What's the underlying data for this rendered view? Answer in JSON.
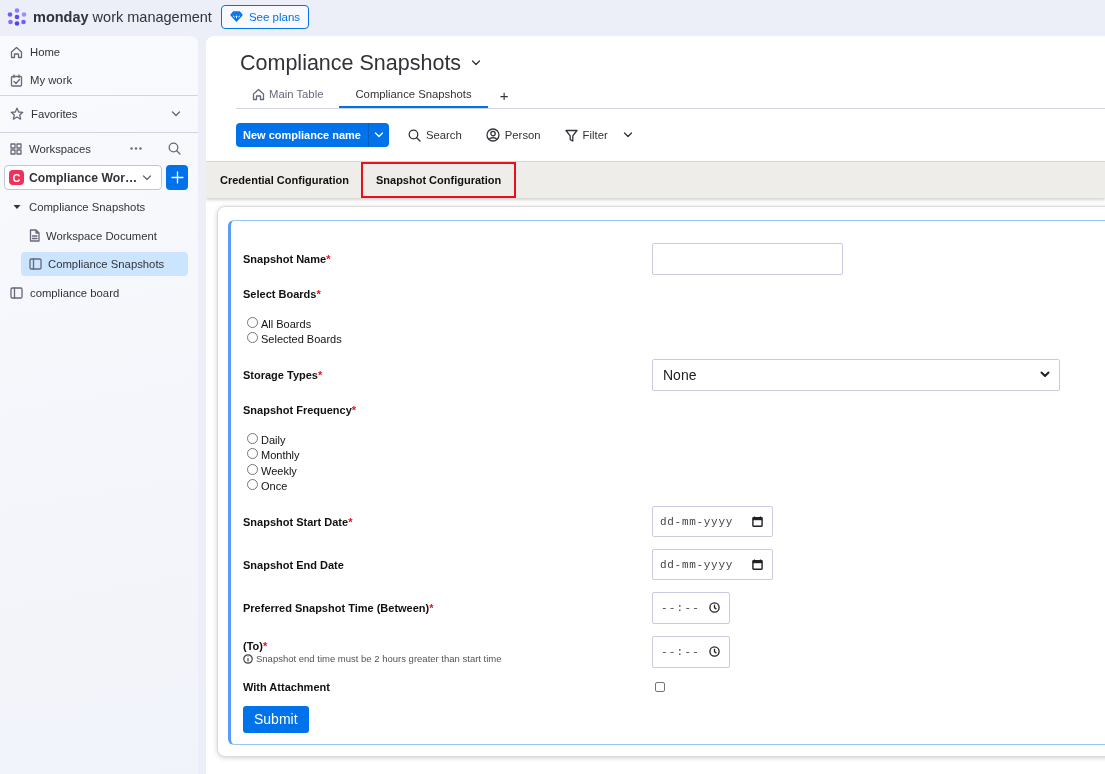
{
  "topbar": {
    "logo": "**monday** work management",
    "plans_button": "See plans"
  },
  "sidebar": {
    "nav": [
      {
        "label": "Home"
      },
      {
        "label": "My work"
      }
    ],
    "favorites": "Favorites",
    "workspaces": "Workspaces",
    "workspace": {
      "initial": "C",
      "name": "Compliance Wor…"
    },
    "tree": [
      {
        "kind": "folder",
        "label": "Compliance Snapshots",
        "expanded": true,
        "selected": false,
        "children": [
          {
            "kind": "doc",
            "label": "Workspace Document",
            "selected": false
          },
          {
            "kind": "board",
            "label": "Compliance Snapshots",
            "selected": true
          }
        ]
      },
      {
        "kind": "board",
        "label": "compliance board",
        "selected": false
      }
    ]
  },
  "board": {
    "title": "Compliance Snapshots",
    "views": [
      {
        "kind": "main",
        "label": "Main Table",
        "selected": false
      },
      {
        "kind": "app",
        "label": "Compliance Snapshots",
        "selected": true
      }
    ],
    "add_view": "+",
    "toolbar": {
      "new_button": "New compliance name",
      "search": "Search",
      "person": "Person",
      "filter": "Filter"
    }
  },
  "config_tabs": [
    {
      "label": "Credential Configuration",
      "selected": false
    },
    {
      "label": "Snapshot Configuration",
      "selected": true
    }
  ],
  "form": {
    "required_mark": "*",
    "fields": [
      {
        "kind": "text",
        "label": "Snapshot Name",
        "required": true
      },
      {
        "kind": "radio",
        "label": "Select Boards",
        "required": true,
        "options": [
          {
            "label": "All Boards",
            "selected": false
          },
          {
            "label": "Selected Boards",
            "selected": false
          }
        ]
      },
      {
        "kind": "select",
        "label": "Storage Types",
        "required": true,
        "value": "None"
      },
      {
        "kind": "radio",
        "label": "Snapshot Frequency",
        "required": true,
        "options": [
          {
            "label": "Daily",
            "selected": false
          },
          {
            "label": "Monthly",
            "selected": false
          },
          {
            "label": "Weekly",
            "selected": false
          },
          {
            "label": "Once",
            "selected": false
          }
        ]
      },
      {
        "kind": "date",
        "label": "Snapshot Start Date",
        "required": true,
        "placeholder": "dd-mm-yyyy"
      },
      {
        "kind": "date",
        "label": "Snapshot End Date",
        "required": false,
        "placeholder": "dd-mm-yyyy"
      },
      {
        "kind": "time",
        "label": "Preferred Snapshot Time (Between)",
        "required": true,
        "placeholder": "--:--"
      },
      {
        "kind": "time",
        "label": "(To)",
        "required": true,
        "placeholder": "--:--",
        "hint": "Snapshot end time must be 2 hours greater than start time"
      },
      {
        "kind": "checkbox",
        "label": "With Attachment",
        "required": false,
        "checked": false
      }
    ],
    "submit": "Submit"
  }
}
